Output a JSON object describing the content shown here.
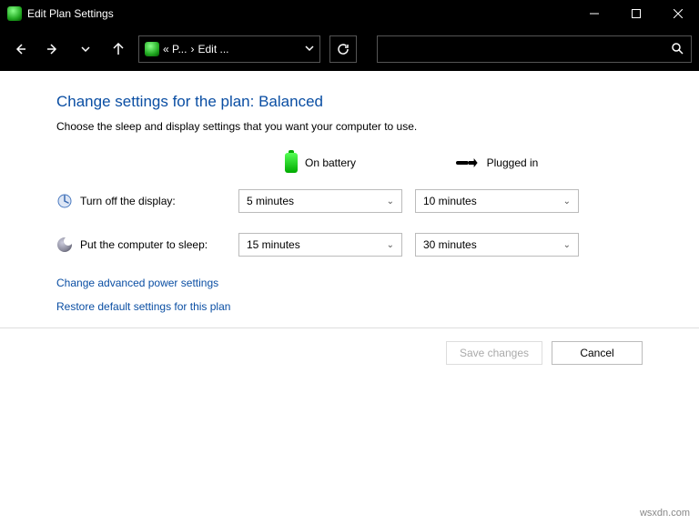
{
  "titlebar": {
    "title": "Edit Plan Settings"
  },
  "address": {
    "seg1": "« P...",
    "sep": "›",
    "seg2": "Edit ..."
  },
  "page": {
    "title": "Change settings for the plan: Balanced",
    "description": "Choose the sleep and display settings that you want your computer to use."
  },
  "columns": {
    "battery": "On battery",
    "plugged": "Plugged in"
  },
  "rows": {
    "display": {
      "label": "Turn off the display:",
      "battery": "5 minutes",
      "plugged": "10 minutes"
    },
    "sleep": {
      "label": "Put the computer to sleep:",
      "battery": "15 minutes",
      "plugged": "30 minutes"
    }
  },
  "links": {
    "advanced": "Change advanced power settings",
    "restore": "Restore default settings for this plan"
  },
  "buttons": {
    "save": "Save changes",
    "cancel": "Cancel"
  },
  "watermark": "wsxdn.com"
}
